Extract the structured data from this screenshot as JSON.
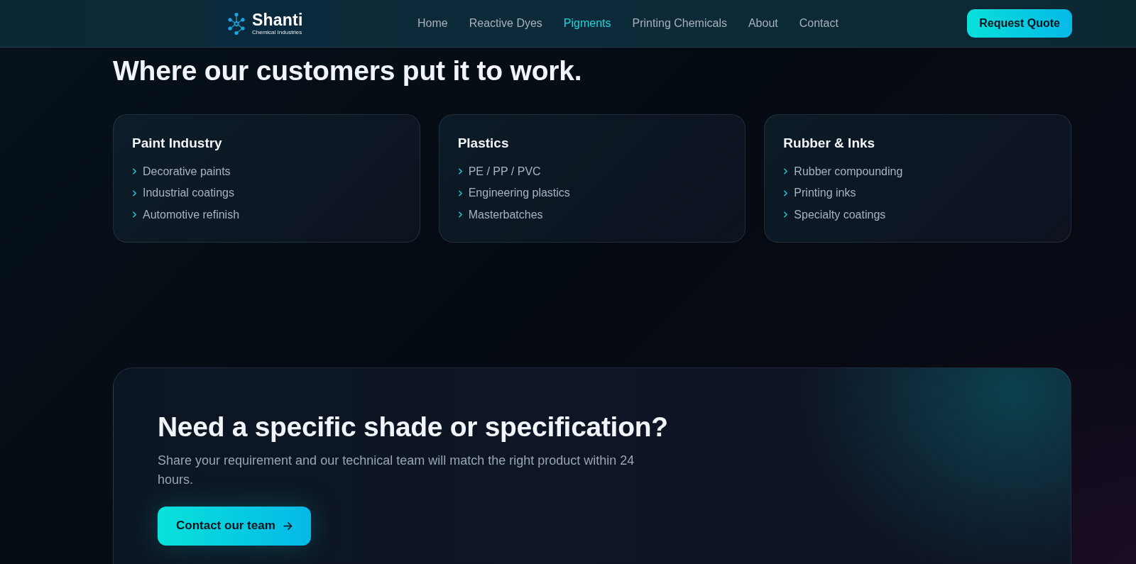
{
  "header": {
    "logo": {
      "name": "Shanti",
      "tagline": "Chemical Industries"
    },
    "nav": [
      {
        "label": "Home",
        "selected": false
      },
      {
        "label": "Reactive Dyes",
        "selected": false
      },
      {
        "label": "Pigments",
        "selected": true
      },
      {
        "label": "Printing Chemicals",
        "selected": false
      },
      {
        "label": "About",
        "selected": false
      },
      {
        "label": "Contact",
        "selected": false
      }
    ],
    "cta_button": "Request Quote"
  },
  "applications": {
    "heading": "Where our customers put it to work.",
    "cards": [
      {
        "title": "Paint Industry",
        "items": [
          "Decorative paints",
          "Industrial coatings",
          "Automotive refinish"
        ]
      },
      {
        "title": "Plastics",
        "items": [
          "PE / PP / PVC",
          "Engineering plastics",
          "Masterbatches"
        ]
      },
      {
        "title": "Rubber & Inks",
        "items": [
          "Rubber compounding",
          "Printing inks",
          "Specialty coatings"
        ]
      }
    ]
  },
  "contact_banner": {
    "heading": "Need a specific shade or specification?",
    "text": "Share your requirement and our technical team will match the right product within 24 hours.",
    "button": "Contact our team"
  }
}
